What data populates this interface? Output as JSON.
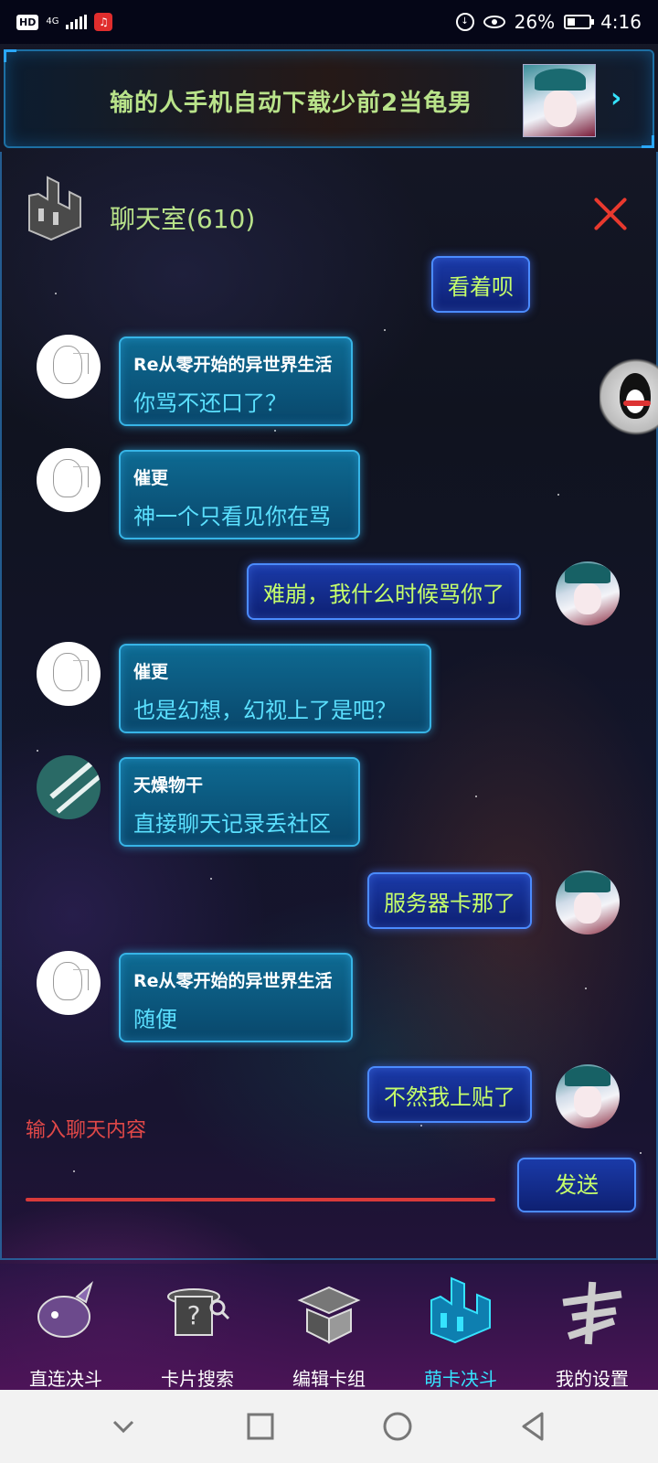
{
  "status_bar": {
    "hd": "HD",
    "network": "4G",
    "battery": "26%",
    "time": "4:16"
  },
  "banner": {
    "text": "输的人手机自动下载少前2当龟男"
  },
  "chat": {
    "title": "聊天室(610)",
    "messages": [
      {
        "side": "self",
        "text": "看着呗"
      },
      {
        "side": "other",
        "name": "Re从零开始的异世界生活",
        "text": "你骂不还口了？",
        "avatar": "sketch"
      },
      {
        "side": "other",
        "name": "催更",
        "text": "神一个只看见你在骂",
        "avatar": "sketch"
      },
      {
        "side": "self",
        "text": "难崩，我什么时候骂你了",
        "avatar": "anime"
      },
      {
        "side": "other",
        "name": "催更",
        "text": "也是幻想，幻视上了是吧？",
        "avatar": "sketch"
      },
      {
        "side": "other",
        "name": "天燥物干",
        "text": "直接聊天记录丢社区",
        "avatar": "teal"
      },
      {
        "side": "self",
        "text": "服务器卡那了",
        "avatar": "anime"
      },
      {
        "side": "other",
        "name": "Re从零开始的异世界生活",
        "text": "随便",
        "avatar": "sketch"
      },
      {
        "side": "self",
        "text": "不然我上贴了",
        "avatar": "anime"
      }
    ],
    "input_placeholder": "输入聊天内容",
    "send_label": "发送"
  },
  "bottom_nav": {
    "items": [
      {
        "label": "直连决斗",
        "icon": "dolphin-icon",
        "active": false
      },
      {
        "label": "卡片搜索",
        "icon": "magician-hat-search-icon",
        "active": false
      },
      {
        "label": "编辑卡组",
        "icon": "card-box-icon",
        "active": false
      },
      {
        "label": "萌卡决斗",
        "icon": "mycard-duel-icon",
        "active": true
      },
      {
        "label": "我的设置",
        "icon": "settings-glyph-icon",
        "active": false
      }
    ]
  },
  "colors": {
    "accent_green": "#b9e38a",
    "accent_cyan": "#35e3ff",
    "self_text": "#c6ff6a",
    "other_text": "#5be0ff",
    "close_red": "#e8392e",
    "input_red": "#d93a3a"
  }
}
